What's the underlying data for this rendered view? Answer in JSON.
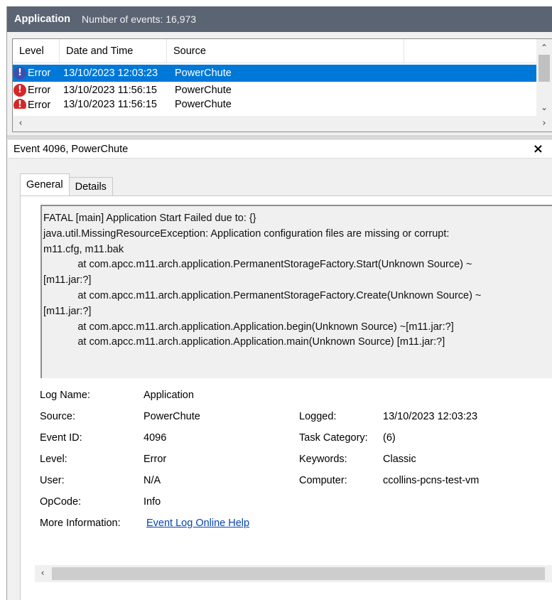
{
  "header": {
    "title": "Application",
    "event_count": "Number of events: 16,973"
  },
  "list": {
    "columns": [
      "Level",
      "Date and Time",
      "Source",
      ""
    ],
    "rows": [
      {
        "level": "Error",
        "datetime": "13/10/2023 12:03:23",
        "source": "PowerChute",
        "selected": true
      },
      {
        "level": "Error",
        "datetime": "13/10/2023 11:56:15",
        "source": "PowerChute",
        "selected": false
      },
      {
        "level": "Error",
        "datetime": "13/10/2023 11:56:15",
        "source": "PowerChute",
        "selected": false
      }
    ]
  },
  "detail": {
    "title": "Event 4096, PowerChute",
    "tabs": [
      "General",
      "Details"
    ],
    "active_tab": "General",
    "description": "FATAL [main] Application Start Failed due to: {}\njava.util.MissingResourceException: Application configuration files are missing or corrupt:\nm11.cfg, m11.bak\n            at com.apcc.m11.arch.application.PermanentStorageFactory.Start(Unknown Source) ~\n[m11.jar:?]\n            at com.apcc.m11.arch.application.PermanentStorageFactory.Create(Unknown Source) ~\n[m11.jar:?]\n            at com.apcc.m11.arch.application.Application.begin(Unknown Source) ~[m11.jar:?]\n            at com.apcc.m11.arch.application.Application.main(Unknown Source) [m11.jar:?]",
    "fields": {
      "log_name_label": "Log Name:",
      "log_name": "Application",
      "source_label": "Source:",
      "source": "PowerChute",
      "logged_label": "Logged:",
      "logged": "13/10/2023 12:03:23",
      "event_id_label": "Event ID:",
      "event_id": "4096",
      "task_category_label": "Task Category:",
      "task_category": "(6)",
      "level_label": "Level:",
      "level": "Error",
      "keywords_label": "Keywords:",
      "keywords": "Classic",
      "user_label": "User:",
      "user": "N/A",
      "computer_label": "Computer:",
      "computer": "ccollins-pcns-test-vm",
      "opcode_label": "OpCode:",
      "opcode": "Info",
      "more_info_label": "More Information:",
      "more_info_link": "Event Log Online Help"
    }
  },
  "colors": {
    "header_bg": "#5b6473",
    "selection": "#0078d7",
    "error_icon": "#d42828",
    "link": "#0645ad"
  },
  "icons": {
    "error": "error-icon",
    "close": "close-icon"
  }
}
